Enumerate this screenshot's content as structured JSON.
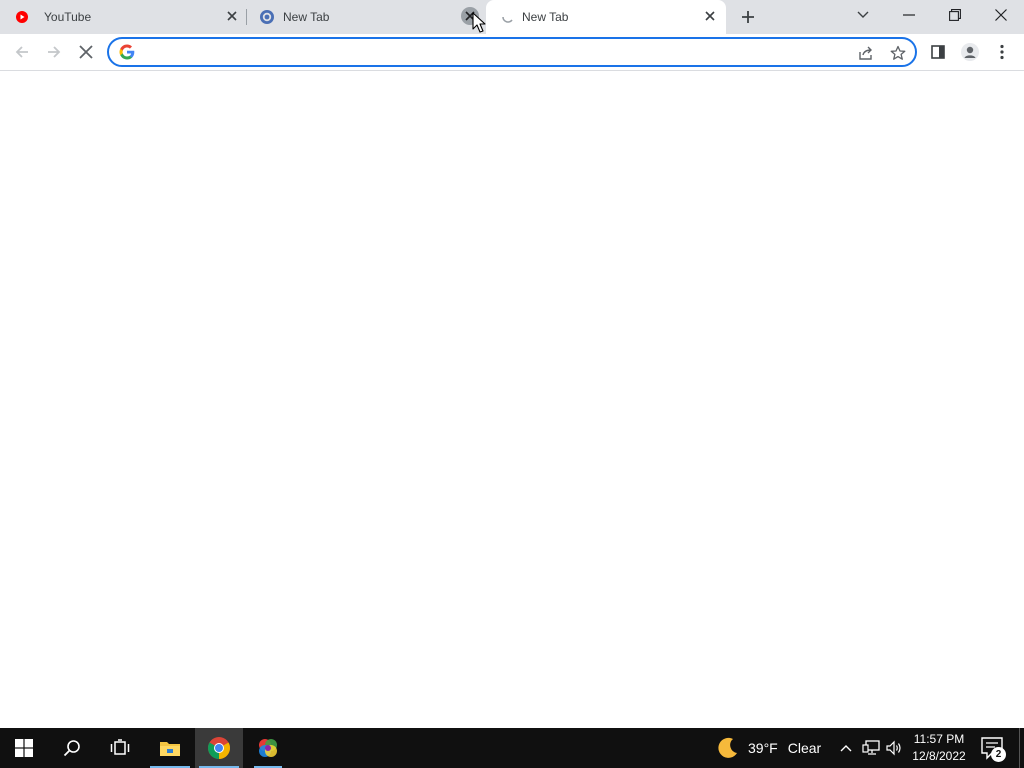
{
  "browser": {
    "tabs": [
      {
        "title": "YouTube",
        "favicon": "youtube-icon",
        "active": false
      },
      {
        "title": "New Tab",
        "favicon": "chrome-custom-icon",
        "active": false
      },
      {
        "title": "New Tab",
        "favicon": "loading-spinner-icon",
        "active": true
      }
    ],
    "new_tab_label": "+",
    "omnibox": {
      "value": "",
      "placeholder": ""
    },
    "accent_color": "#1a73e8"
  },
  "taskbar": {
    "weather": {
      "temp": "39°F",
      "condition": "Clear"
    },
    "clock": {
      "time": "11:57 PM",
      "date": "12/8/2022"
    },
    "notification_count": "2"
  }
}
